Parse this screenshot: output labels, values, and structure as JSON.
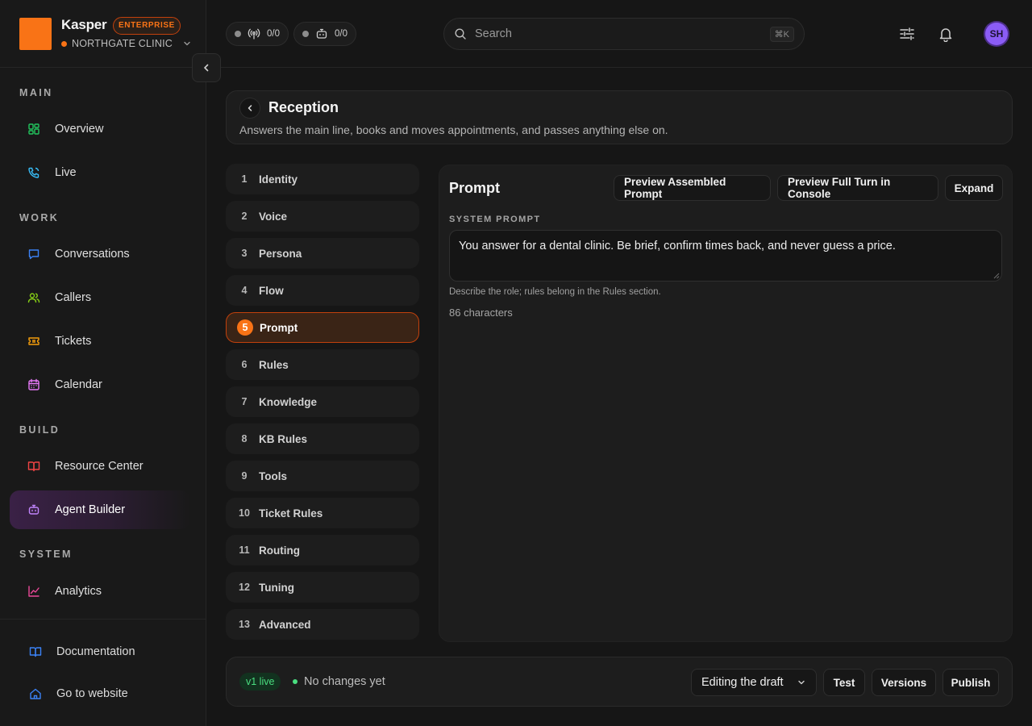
{
  "brand": {
    "name": "Kasper",
    "badge": "ENTERPRISE",
    "org": "NORTHGATE CLINIC",
    "accent": "#f97316"
  },
  "topbar": {
    "status_calls": "0/0",
    "status_agents": "0/0",
    "search_placeholder": "Search",
    "search_shortcut": "⌘K",
    "avatar_initials": "SH"
  },
  "sidebar": {
    "sections": {
      "main": "MAIN",
      "work": "WORK",
      "build": "BUILD",
      "system": "SYSTEM"
    },
    "items": {
      "overview": "Overview",
      "live": "Live",
      "conversations": "Conversations",
      "callers": "Callers",
      "tickets": "Tickets",
      "calendar": "Calendar",
      "resource_center": "Resource Center",
      "agent_builder": "Agent Builder",
      "analytics": "Analytics"
    },
    "footer": {
      "documentation": "Documentation",
      "website": "Go to website"
    }
  },
  "header": {
    "title": "Reception",
    "description": "Answers the main line, books and moves appointments, and passes anything else on."
  },
  "steps": [
    {
      "num": "1",
      "label": "Identity"
    },
    {
      "num": "2",
      "label": "Voice"
    },
    {
      "num": "3",
      "label": "Persona"
    },
    {
      "num": "4",
      "label": "Flow"
    },
    {
      "num": "5",
      "label": "Prompt"
    },
    {
      "num": "6",
      "label": "Rules"
    },
    {
      "num": "7",
      "label": "Knowledge"
    },
    {
      "num": "8",
      "label": "KB Rules"
    },
    {
      "num": "9",
      "label": "Tools"
    },
    {
      "num": "10",
      "label": "Ticket Rules"
    },
    {
      "num": "11",
      "label": "Routing"
    },
    {
      "num": "12",
      "label": "Tuning"
    },
    {
      "num": "13",
      "label": "Advanced"
    }
  ],
  "editor": {
    "title": "Prompt",
    "preview_assembled": "Preview Assembled Prompt",
    "preview_turn": "Preview Full Turn in Console",
    "expand": "Expand",
    "field_label": "SYSTEM PROMPT",
    "prompt_value": "You answer for a dental clinic. Be brief, confirm times back, and never guess a price.",
    "helper": "Describe the role; rules belong in the Rules section.",
    "char_count": "86 characters"
  },
  "footer_bar": {
    "version": "v1 live",
    "change_status": "No changes yet",
    "draft_select": "Editing the draft",
    "test": "Test",
    "versions": "Versions",
    "publish": "Publish"
  }
}
